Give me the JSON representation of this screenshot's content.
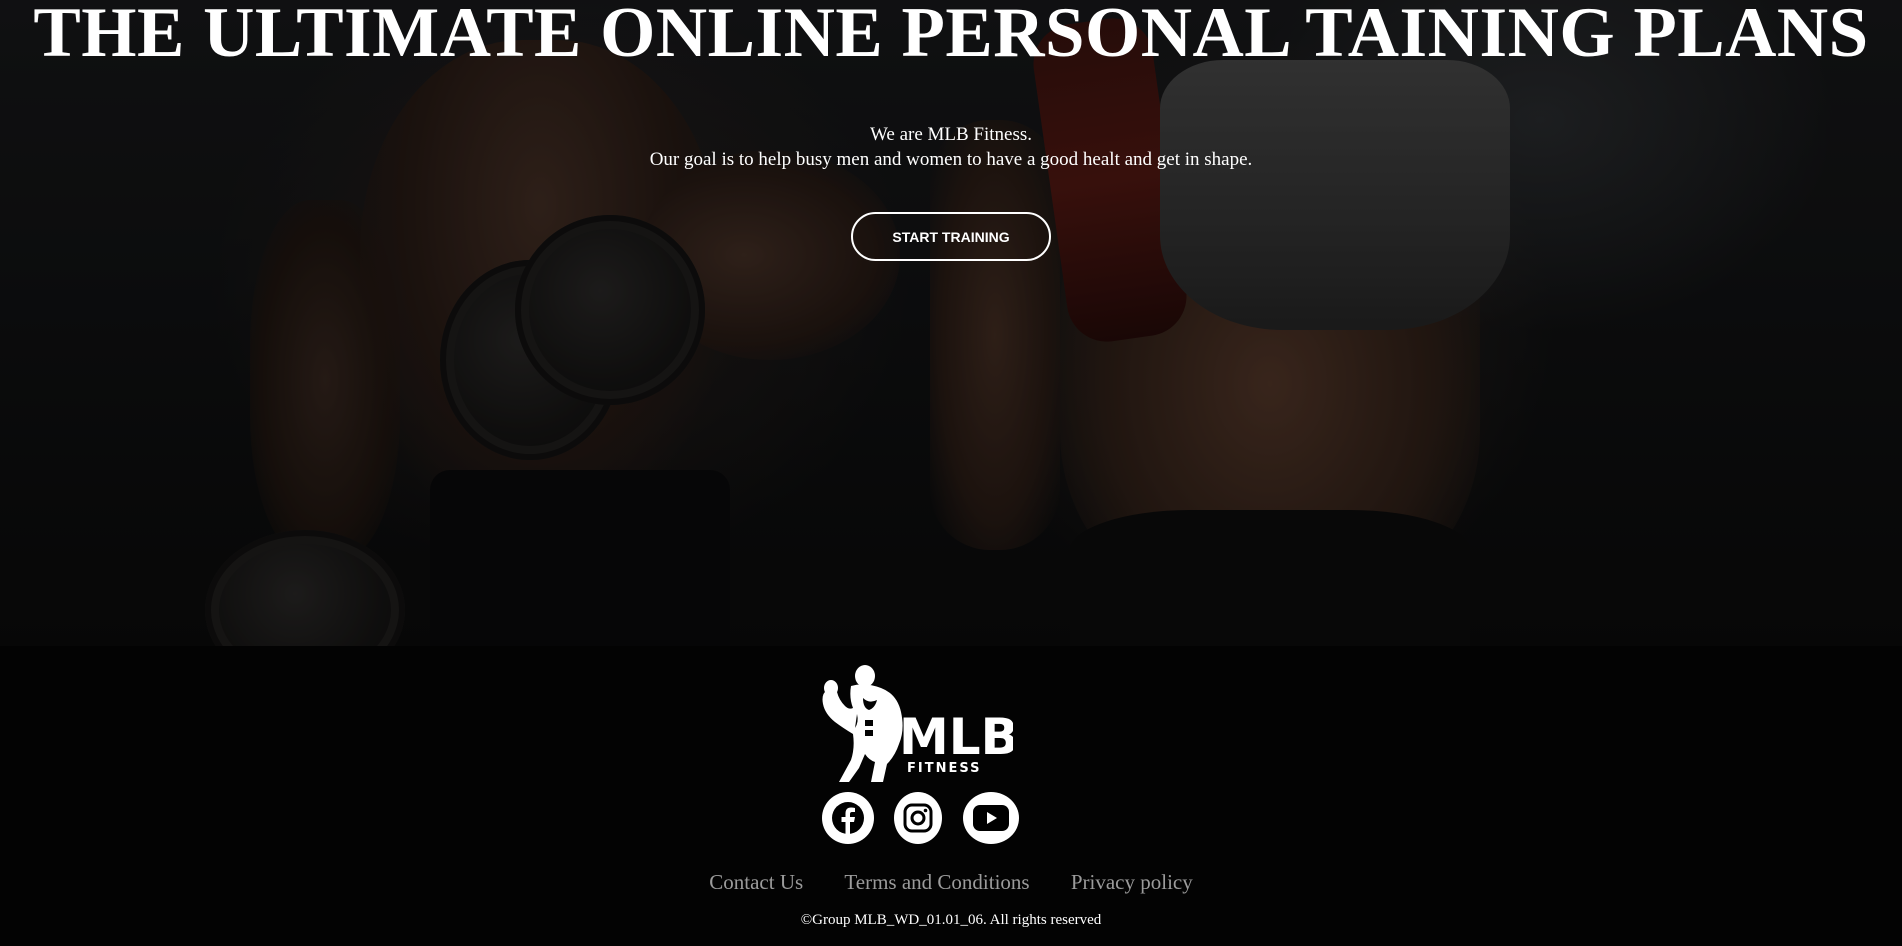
{
  "hero": {
    "title": "THE ULTIMATE ONLINE PERSONAL TAINING PLANS",
    "intro_line1": "We are MLB Fitness.",
    "intro_line2": "Our goal is to help busy men and women to have a good healt and get in shape.",
    "cta_label": "START TRAINING"
  },
  "footer": {
    "logo": {
      "main_text": "MLB",
      "sub_text": "FITNESS",
      "icon": "bodybuilder-icon"
    },
    "socials": [
      {
        "name": "facebook-icon"
      },
      {
        "name": "instagram-icon"
      },
      {
        "name": "youtube-icon"
      }
    ],
    "links": {
      "contact": "Contact Us",
      "terms": "Terms and Conditions",
      "privacy": "Privacy policy"
    },
    "copyright": "©Group MLB_WD_01.01_06. All rights reserved"
  },
  "colors": {
    "background": "#030303",
    "text": "#ffffff",
    "footer_link": "#9b9b9b"
  }
}
